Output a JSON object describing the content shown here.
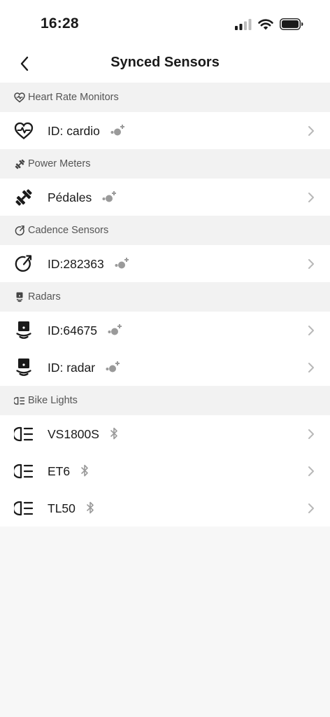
{
  "status_bar": {
    "time": "16:28"
  },
  "header": {
    "title": "Synced Sensors",
    "back_icon": "chevron-left-icon"
  },
  "sections": [
    {
      "label": "Heart Rate Monitors",
      "icon": "heart-pulse-icon",
      "items": [
        {
          "name": "ID: cardio",
          "badge": "ant-plus-icon"
        }
      ]
    },
    {
      "label": "Power Meters",
      "icon": "dumbbell-icon",
      "items": [
        {
          "name": "Pédales",
          "badge": "ant-plus-icon"
        }
      ]
    },
    {
      "label": "Cadence Sensors",
      "icon": "cadence-icon",
      "items": [
        {
          "name": "ID:282363",
          "badge": "ant-plus-icon"
        }
      ]
    },
    {
      "label": "Radars",
      "icon": "radar-icon",
      "items": [
        {
          "name": "ID:64675",
          "badge": "ant-plus-icon"
        },
        {
          "name": "ID: radar",
          "badge": "ant-plus-icon"
        }
      ]
    },
    {
      "label": "Bike Lights",
      "icon": "bike-light-icon",
      "items": [
        {
          "name": "VS1800S",
          "badge": "bluetooth-icon"
        },
        {
          "name": "ET6",
          "badge": "bluetooth-icon"
        },
        {
          "name": "TL50",
          "badge": "bluetooth-icon"
        }
      ]
    }
  ],
  "colors": {
    "background": "#f7f7f7",
    "section_bg": "#f2f2f2",
    "row_bg": "#ffffff",
    "badge_gray": "#9a9a9a",
    "chevron_gray": "#b8b8b8"
  }
}
